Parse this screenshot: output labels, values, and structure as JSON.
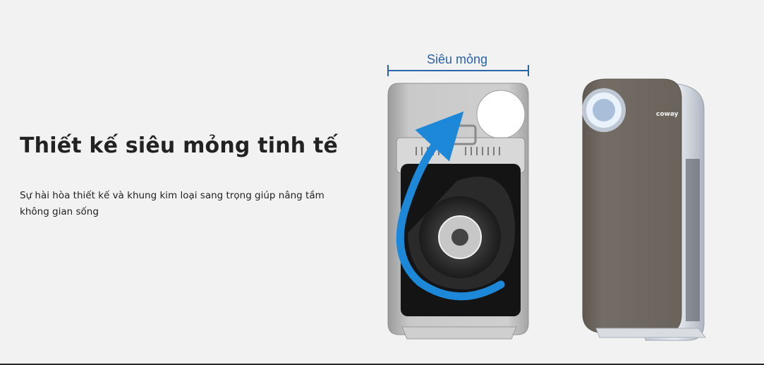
{
  "section": {
    "headline": "Thiết kế siêu mỏng tinh tế",
    "description": "Sự hài hòa thiết kế và khung kim loại sang trọng giúp nâng tầm không gian sống"
  },
  "illustration": {
    "width_label": "Siêu mỏng",
    "brand_label": "coway",
    "airflow_color": "#1e88d8",
    "dimension_color": "#2a62a8",
    "front_panel_color": "#716a62"
  }
}
